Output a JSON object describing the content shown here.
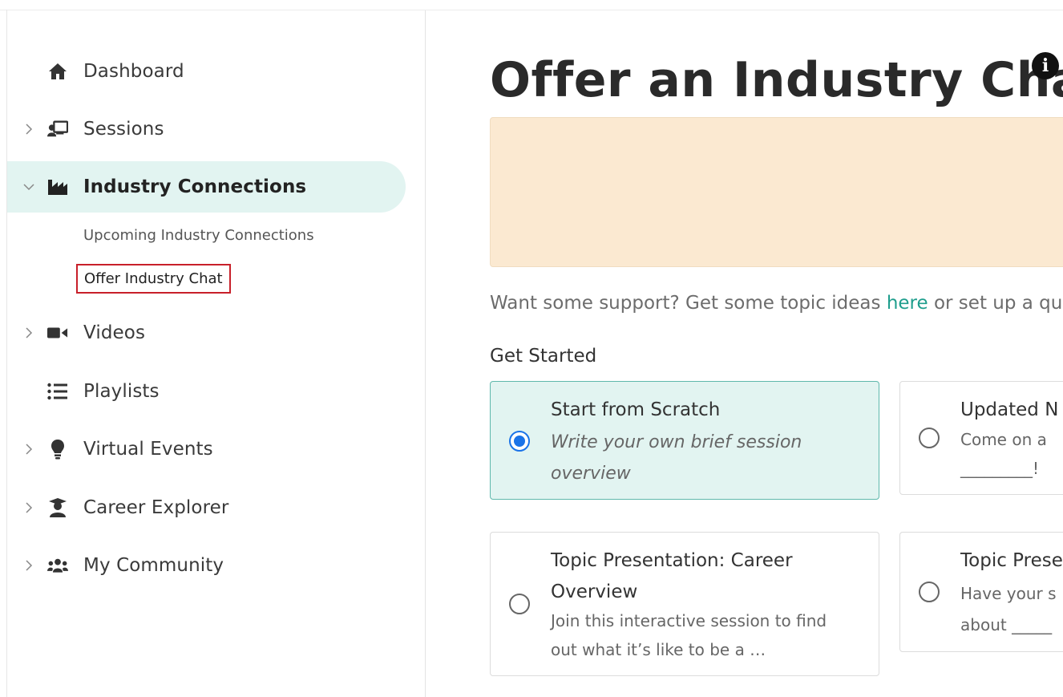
{
  "sidebar": {
    "items": [
      {
        "label": "Dashboard",
        "icon": "home-icon"
      },
      {
        "label": "Sessions",
        "icon": "presentation-icon"
      },
      {
        "label": "Industry Connections",
        "icon": "factory-icon"
      },
      {
        "label": "Videos",
        "icon": "video-camera-icon"
      },
      {
        "label": "Playlists",
        "icon": "list-icon"
      },
      {
        "label": "Virtual Events",
        "icon": "lightbulb-icon"
      },
      {
        "label": "Career Explorer",
        "icon": "graduate-icon"
      },
      {
        "label": "My Community",
        "icon": "users-icon"
      }
    ],
    "subitems": [
      {
        "label": "Upcoming Industry Connections"
      },
      {
        "label": "Offer Industry Chat"
      }
    ]
  },
  "main": {
    "title": "Offer an Industry Chat",
    "support_prefix": "Want some support? Get some topic ideas ",
    "support_link": "here",
    "support_suffix": " or set up a qu",
    "get_started": "Get Started",
    "cards": [
      {
        "title": "Start from Scratch",
        "desc_line1": "Write your own brief session",
        "desc_line2": "overview",
        "selected": true
      },
      {
        "title": "Updated N",
        "desc_line1": "Come on a ",
        "desc_line2": "_________!",
        "selected": false
      },
      {
        "title_line1": "Topic Presentation: Career",
        "title_line2": "Overview",
        "desc_line1": "Join this interactive session to find",
        "desc_line2": "out what it’s like to be a …",
        "selected": false
      },
      {
        "title": "Topic Prese",
        "desc_line1": "Have your s",
        "desc_line2": "about _____",
        "selected": false
      }
    ]
  },
  "colors": {
    "accent": "#1f9e8d",
    "active_bg": "#e2f4f1",
    "banner_bg": "#fbe9d1",
    "radio_checked": "#1a73e8",
    "highlight_border": "#c8202a"
  }
}
